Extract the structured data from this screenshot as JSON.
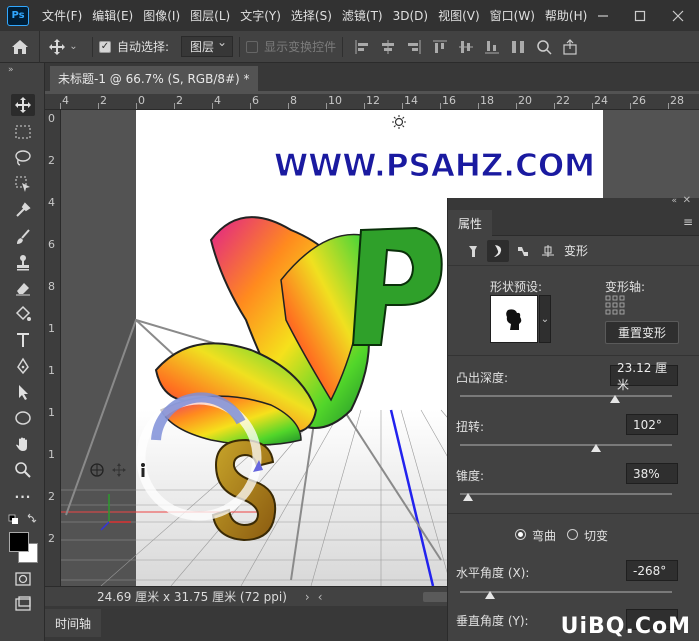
{
  "app": {
    "logo": "Ps"
  },
  "menu": [
    "文件(F)",
    "编辑(E)",
    "图像(I)",
    "图层(L)",
    "文字(Y)",
    "选择(S)",
    "滤镜(T)",
    "3D(D)",
    "视图(V)",
    "窗口(W)",
    "帮助(H)"
  ],
  "options": {
    "auto_select_label": "自动选择:",
    "auto_select_value": "图层",
    "show_transform_label": "显示变换控件"
  },
  "document": {
    "tab_title": "未标题-1 @ 66.7% (S, RGB/8#) *",
    "canvas_text": "WWW.PSAHZ.COM",
    "ruler_h": [
      "4",
      "2",
      "0",
      "2",
      "4",
      "6",
      "8",
      "10",
      "12",
      "14",
      "16",
      "18",
      "20",
      "22",
      "24",
      "26",
      "28"
    ],
    "ruler_v": [
      "0",
      "2",
      "4",
      "6",
      "8",
      "1",
      "1",
      "1",
      "1",
      "2",
      "2"
    ]
  },
  "status": {
    "size_text": "24.69 厘米 x 31.75 厘米 (72 ppi)"
  },
  "timeline": {
    "label": "时间轴"
  },
  "panel": {
    "title": "属性",
    "section_label": "变形",
    "shape_preset_label": "形状预设:",
    "deform_axis_label": "变形轴:",
    "reset_button": "重置变形",
    "extrude_label": "凸出深度:",
    "extrude_value": "23.12 厘米",
    "extrude_level": 0.73,
    "twist_label": "扭转:",
    "twist_value": "102°",
    "twist_level": 0.64,
    "taper_label": "锥度:",
    "taper_value": "38%",
    "taper_level": 0.04,
    "bend_label": "弯曲",
    "shear_label": "切变",
    "h_angle_label": "水平角度 (X):",
    "h_angle_value": "-268°",
    "h_angle_level": 0.14,
    "v_angle_label": "垂直角度 (Y):"
  },
  "watermark": "UiBQ.CoM",
  "colors": {
    "accent": "#31a8ff",
    "panel_bg": "#424242",
    "menu_bg": "#323232"
  }
}
